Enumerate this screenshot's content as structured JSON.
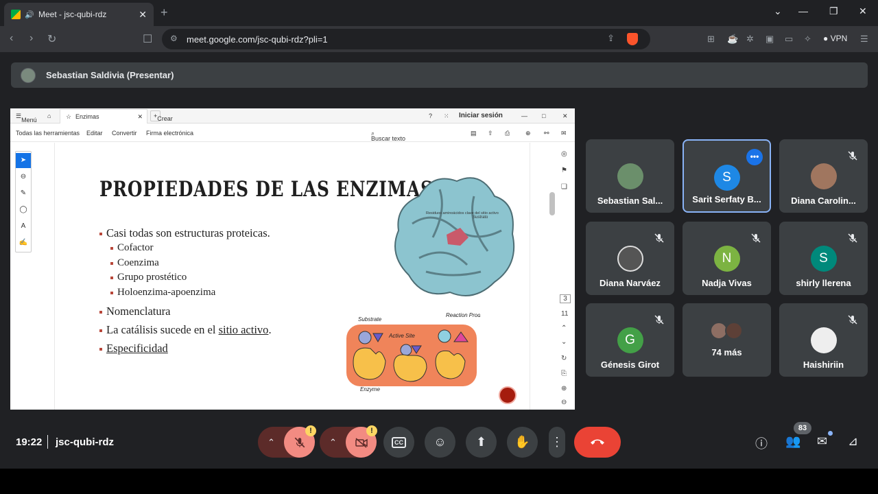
{
  "browser": {
    "tab_title": "Meet - jsc-qubi-rdz",
    "tab_close": "✕",
    "new_tab": "+",
    "url": "meet.google.com/jsc-qubi-rdz?pli=1",
    "vpn_label": "VPN"
  },
  "presenter": {
    "name": "Sebastian Saldivia (Presentar)"
  },
  "acrobat": {
    "menu": "Menú",
    "tab_title": "Enzimas",
    "create": "Crear",
    "signin": "Iniciar sesión",
    "tools": [
      "Todas las herramientas",
      "Editar",
      "Convertir",
      "Firma electrónica"
    ],
    "search_placeholder": "Buscar texto o herramientas",
    "page_current": "3",
    "page_total": "11"
  },
  "slide": {
    "title": "PROPIEDADES DE LAS ENZIMAS",
    "bullet1": "Casi todas son estructuras proteicas.",
    "sub1": "Cofactor",
    "sub2": "Coenzima",
    "sub3": "Grupo prostético",
    "sub4": "Holoenzima-apoenzima",
    "bullet2": "Nomenclatura",
    "bullet3_pre": "La catálisis sucede en el ",
    "bullet3_link": "sitio activo",
    "bullet3_post": ".",
    "bullet4": "Especificidad",
    "protein_label1": "Residuos aminoácidos clave del sitio activo",
    "protein_label2": "Sustrato",
    "diagram_substrate": "Substrate",
    "diagram_products": "Reaction Products",
    "diagram_site": "Active Site",
    "diagram_enzyme": "Enzyme"
  },
  "participants": [
    {
      "name": "Sebastian Sal...",
      "avatar": "photo",
      "muted": false
    },
    {
      "name": "Sarit Serfaty B...",
      "avatar": "S",
      "color": "#1e88e5",
      "active": true
    },
    {
      "name": "Diana Carolin...",
      "avatar": "photo",
      "muted": true
    },
    {
      "name": "Diana Narváez",
      "avatar": "photo",
      "muted": true
    },
    {
      "name": "Nadja Vivas",
      "avatar": "N",
      "color": "#7cb342",
      "muted": true
    },
    {
      "name": "shirly llerena",
      "avatar": "S",
      "color": "#00897b",
      "muted": true
    },
    {
      "name": "Génesis Girot",
      "avatar": "G",
      "color": "#43a047",
      "muted": true
    },
    {
      "name": "74 más",
      "avatar": "group"
    },
    {
      "name": "Haishiriin",
      "avatar": "photo",
      "muted": true
    }
  ],
  "bottom": {
    "time": "19:22",
    "meeting_code": "jsc-qubi-rdz",
    "people_count": "83",
    "warn_mark": "!"
  },
  "colors": {
    "meet_bg": "#202124",
    "tile_bg": "#3c4043",
    "hangup": "#ea4335",
    "muted_ctl": "#f28b82",
    "active_border": "#8ab4f8"
  }
}
